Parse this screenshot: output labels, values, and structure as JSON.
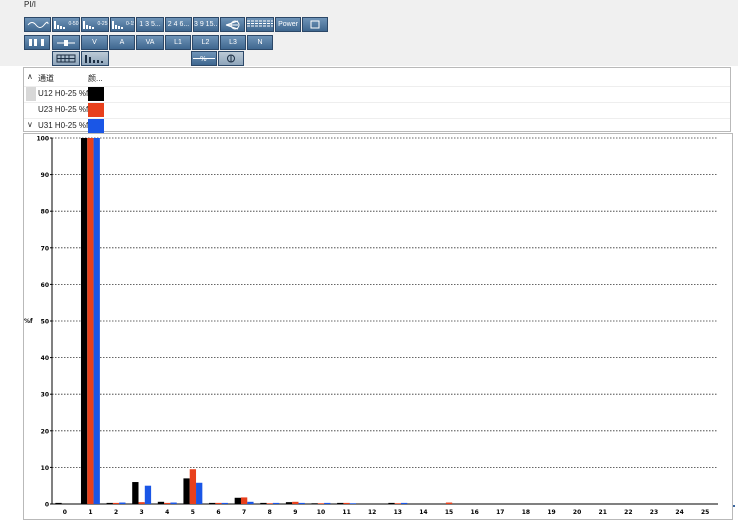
{
  "window": {
    "title": "PI/I"
  },
  "toolbar": {
    "row1": [
      {
        "name": "waveform-button",
        "icon": "waveform-icon",
        "label": ""
      },
      {
        "name": "harmonic-0-50-button",
        "icon": "harmonic-bars-icon",
        "label": "0-50"
      },
      {
        "name": "harmonic-0-25-button",
        "icon": "harmonic-bars-icon",
        "label": "0-25"
      },
      {
        "name": "harmonic-0-15-button",
        "icon": "harmonic-bars-icon",
        "label": "0-15"
      },
      {
        "name": "odd-harmonics-button",
        "icon": "",
        "label": "1 3 5..."
      },
      {
        "name": "even-harmonics-button",
        "icon": "",
        "label": "2 4 6..."
      },
      {
        "name": "triplen-harmonics-button",
        "icon": "",
        "label": "3 9 15..."
      },
      {
        "name": "phasor-button",
        "icon": "phasor-icon",
        "label": ""
      },
      {
        "name": "table-button",
        "icon": "table-icon",
        "label": ""
      },
      {
        "name": "power-button",
        "icon": "",
        "label": "Power"
      },
      {
        "name": "export-button",
        "icon": "export-icon",
        "label": ""
      }
    ],
    "row2": [
      {
        "name": "channels-button",
        "icon": "channels-icon",
        "label": ""
      },
      {
        "name": "u-button",
        "icon": "u-icon",
        "label": ""
      },
      {
        "name": "v-button",
        "icon": "",
        "label": "V"
      },
      {
        "name": "a-button",
        "icon": "",
        "label": "A"
      },
      {
        "name": "va-button",
        "icon": "",
        "label": "VA"
      },
      {
        "name": "l1-button",
        "icon": "",
        "label": "L1"
      },
      {
        "name": "l2-button",
        "icon": "",
        "label": "L2"
      },
      {
        "name": "l3-button",
        "icon": "",
        "label": "L3"
      },
      {
        "name": "n-button",
        "icon": "",
        "label": "N"
      }
    ],
    "row3": [
      {
        "name": "grid-view-button",
        "icon": "grid-icon",
        "label": ""
      },
      {
        "name": "bar-view-button",
        "icon": "bar-view-icon",
        "label": ""
      },
      {
        "name": "percent-button",
        "icon": "percent-icon",
        "label": ""
      },
      {
        "name": "phase-angle-button",
        "icon": "phase-angle-icon",
        "label": ""
      }
    ]
  },
  "legend": {
    "header_channel": "通道",
    "header_color": "颜...",
    "rows": [
      {
        "label": "U12 H0-25 %f",
        "color": "#000000"
      },
      {
        "label": "U23 H0-25 %f",
        "color": "#e8401c"
      },
      {
        "label": "U31 H0-25 %f",
        "color": "#1a56e6"
      }
    ]
  },
  "chart_data": {
    "type": "bar",
    "ylabel": "%f",
    "xlabel": "",
    "ylim": [
      0,
      100
    ],
    "yticks": [
      0,
      10,
      20,
      30,
      40,
      50,
      60,
      70,
      80,
      90,
      100
    ],
    "grid": "horizontal-dotted",
    "categories": [
      "0",
      "1",
      "2",
      "3",
      "4",
      "5",
      "6",
      "7",
      "8",
      "9",
      "10",
      "11",
      "12",
      "13",
      "14",
      "15",
      "16",
      "17",
      "18",
      "19",
      "20",
      "21",
      "22",
      "23",
      "24",
      "25"
    ],
    "series": [
      {
        "name": "U12 H0-25 %f",
        "color": "#000000",
        "values": [
          0.3,
          100,
          0.3,
          6,
          0.6,
          7,
          0.3,
          1.7,
          0.3,
          0.5,
          0.2,
          0.3,
          0,
          0.3,
          0,
          0,
          0,
          0,
          0,
          0,
          0,
          0,
          0,
          0,
          0,
          0
        ]
      },
      {
        "name": "U23 H0-25 %f",
        "color": "#e8401c",
        "values": [
          0,
          100,
          0.3,
          0.5,
          0.3,
          9.5,
          0.3,
          1.8,
          0.2,
          0.6,
          0.2,
          0.3,
          0,
          0.2,
          0,
          0.4,
          0,
          0,
          0,
          0,
          0,
          0,
          0,
          0,
          0,
          0
        ]
      },
      {
        "name": "U31 H0-25 %f",
        "color": "#1a56e6",
        "values": [
          0,
          100,
          0.4,
          5,
          0.4,
          5.8,
          0.3,
          0.6,
          0.3,
          0.3,
          0.3,
          0.2,
          0,
          0.3,
          0,
          0,
          0,
          0,
          0,
          0,
          0,
          0,
          0,
          0,
          0,
          0
        ]
      }
    ]
  }
}
